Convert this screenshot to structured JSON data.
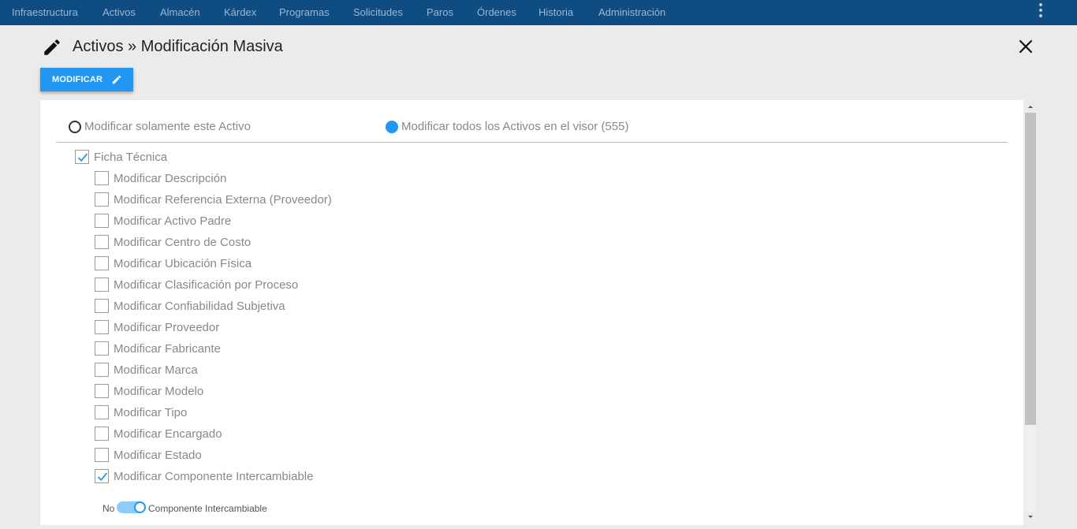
{
  "nav": {
    "items": [
      "Infraestructura",
      "Activos",
      "Almacén",
      "Kárdex",
      "Programas",
      "Solicitudes",
      "Paros",
      "Órdenes",
      "Historia",
      "Administración"
    ]
  },
  "header": {
    "title": "Activos » Modificación Masiva"
  },
  "toolbar": {
    "modify_label": "MODIFICAR"
  },
  "scope": {
    "option_single": "Modificar solamente este Activo",
    "option_all": "Modificar todos los Activos en el visor (555)",
    "selected": "all"
  },
  "ficha": {
    "label": "Ficha Técnica",
    "checked": true,
    "fields": [
      {
        "label": "Modificar Descripción",
        "checked": false
      },
      {
        "label": "Modificar Referencia Externa (Proveedor)",
        "checked": false
      },
      {
        "label": "Modificar Activo Padre",
        "checked": false
      },
      {
        "label": "Modificar Centro de Costo",
        "checked": false
      },
      {
        "label": "Modificar Ubicación Física",
        "checked": false
      },
      {
        "label": "Modificar Clasificación por Proceso",
        "checked": false
      },
      {
        "label": "Modificar Confiabilidad Subjetiva",
        "checked": false
      },
      {
        "label": "Modificar Proveedor",
        "checked": false
      },
      {
        "label": "Modificar Fabricante",
        "checked": false
      },
      {
        "label": "Modificar Marca",
        "checked": false
      },
      {
        "label": "Modificar Modelo",
        "checked": false
      },
      {
        "label": "Modificar Tipo",
        "checked": false
      },
      {
        "label": "Modificar Encargado",
        "checked": false
      },
      {
        "label": "Modificar Estado",
        "checked": false
      },
      {
        "label": "Modificar Componente Intercambiable",
        "checked": true
      }
    ]
  },
  "toggle": {
    "off_label": "No",
    "label": "Componente Intercambiable",
    "on": true
  },
  "colors": {
    "topbar": "#0f4c81",
    "accent": "#2196f3"
  }
}
